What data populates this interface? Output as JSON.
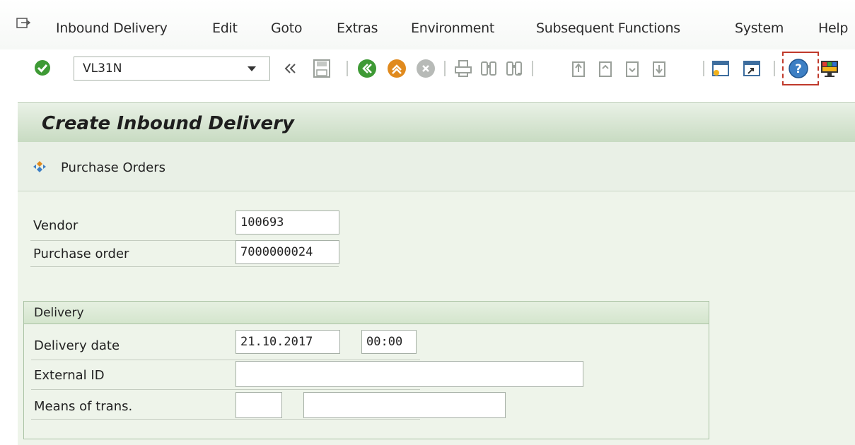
{
  "menu": {
    "items": [
      "Inbound Delivery",
      "Edit",
      "Goto",
      "Extras",
      "Environment",
      "Subsequent Functions",
      "System",
      "Help"
    ],
    "icon": "menu-exit-icon"
  },
  "toolbar": {
    "command_value": "VL31N",
    "icons": [
      "enter-icon",
      "fast-back-icon",
      "save-icon",
      "back-icon",
      "exit-icon",
      "cancel-icon",
      "print-icon",
      "find-icon",
      "find-next-icon",
      "first-page-icon",
      "previous-page-icon",
      "next-page-icon",
      "last-page-icon",
      "create-session-icon",
      "shortcut-icon",
      "help-icon",
      "customize-layout-icon"
    ]
  },
  "page": {
    "title": "Create Inbound Delivery",
    "app_toolbar": {
      "purchase_orders_label": "Purchase Orders"
    }
  },
  "form": {
    "vendor": {
      "label": "Vendor",
      "value": "100693"
    },
    "purchase_order": {
      "label": "Purchase order",
      "value": "7000000024"
    },
    "delivery_group": {
      "title": "Delivery",
      "delivery_date": {
        "label": "Delivery date",
        "date": "21.10.2017",
        "time": "00:00"
      },
      "external_id": {
        "label": "External ID",
        "value": ""
      },
      "means_of_trans": {
        "label": "Means of trans.",
        "value1": "",
        "value2": ""
      }
    }
  },
  "colors": {
    "title_bar": "#c8dbc2",
    "form_bg": "#eef4ea",
    "ok_green": "#3e9a35",
    "accent_orange": "#e08a1e",
    "help_blue": "#3d7fc4"
  }
}
